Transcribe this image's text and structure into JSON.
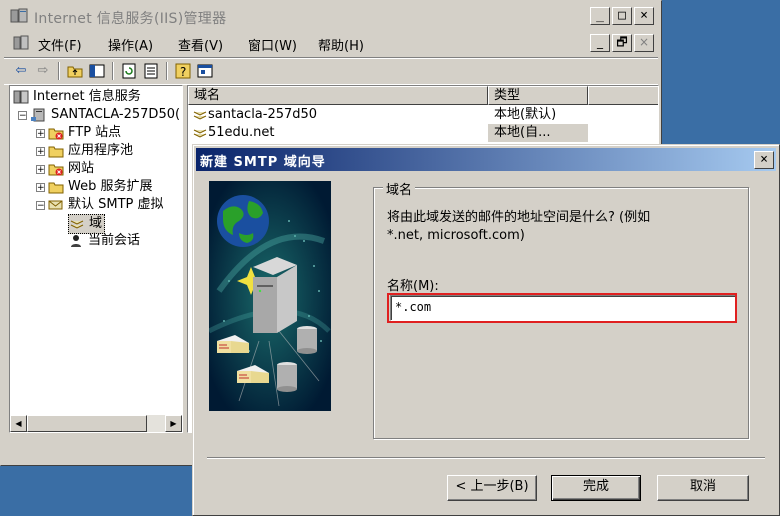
{
  "iis_window": {
    "title": "Internet 信息服务(IIS)管理器",
    "menu": [
      "文件(F)",
      "操作(A)",
      "查看(V)",
      "窗口(W)",
      "帮助(H)"
    ],
    "caption_buttons": [
      "_",
      "□",
      "×"
    ],
    "mdi_buttons": [
      "_",
      "🗗",
      "×"
    ]
  },
  "tree": {
    "root": "Internet 信息服务",
    "server": "SANTACLA-257D50(",
    "items": [
      {
        "label": "FTP 站点"
      },
      {
        "label": "应用程序池"
      },
      {
        "label": "网站"
      },
      {
        "label": "Web 服务扩展"
      },
      {
        "label": "默认 SMTP 虚拟"
      }
    ],
    "subitems": [
      {
        "label": "域"
      },
      {
        "label": "当前会话"
      }
    ]
  },
  "list": {
    "columns": [
      "域名",
      "类型"
    ],
    "rows": [
      {
        "name": "santacla-257d50",
        "type": "本地(默认)"
      },
      {
        "name": "51edu.net",
        "type": "本地(自..."
      }
    ]
  },
  "wizard": {
    "title": "新建 SMTP 域向导",
    "group_title": "域名",
    "description_line1": "将由此域发送的邮件的地址空间是什么? (例如",
    "description_line2": "*.net, microsoft.com)",
    "field_label": "名称(M):",
    "field_value": "*.com",
    "buttons": {
      "back": "< 上一步(B)",
      "finish": "完成",
      "cancel": "取消"
    },
    "close": "×"
  },
  "colors": {
    "desktop": "#3a6ea5",
    "face": "#d4d0c8",
    "active_title_start": "#0a246a",
    "active_title_end": "#a6caf0",
    "highlight_box": "#e02020"
  }
}
